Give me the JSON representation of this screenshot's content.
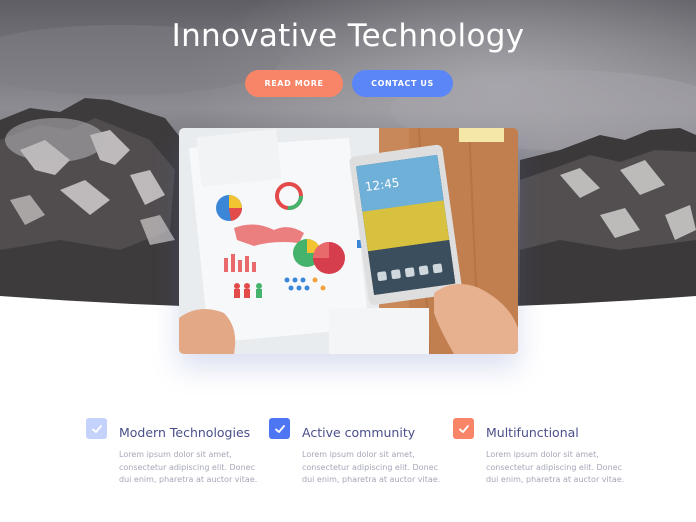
{
  "hero": {
    "title": "Innovative Technology",
    "read_more_label": "READ MORE",
    "contact_label": "CONTACT US"
  },
  "colors": {
    "read_more_bg": "#f98568",
    "contact_bg": "#5b86f7",
    "check_light": "#c5d2fb",
    "check_blue": "#4f76f2",
    "check_orange": "#f98568",
    "feature_title": "#4a4f8a",
    "feature_desc": "#a5a7b8"
  },
  "features": [
    {
      "icon": "check-icon",
      "title": "Modern Technologies",
      "desc": "Lorem ipsum dolor sit amet, consectetur adipiscing elit. Donec dui enim, pharetra at auctor vitae."
    },
    {
      "icon": "check-icon",
      "title": "Active community",
      "desc": "Lorem ipsum dolor sit amet, consectetur adipiscing elit. Donec dui enim, pharetra at auctor vitae."
    },
    {
      "icon": "check-icon",
      "title": "Multifunctional",
      "desc": "Lorem ipsum dolor sit amet, consectetur adipiscing elit. Donec dui enim, pharetra at auctor vitae."
    }
  ]
}
